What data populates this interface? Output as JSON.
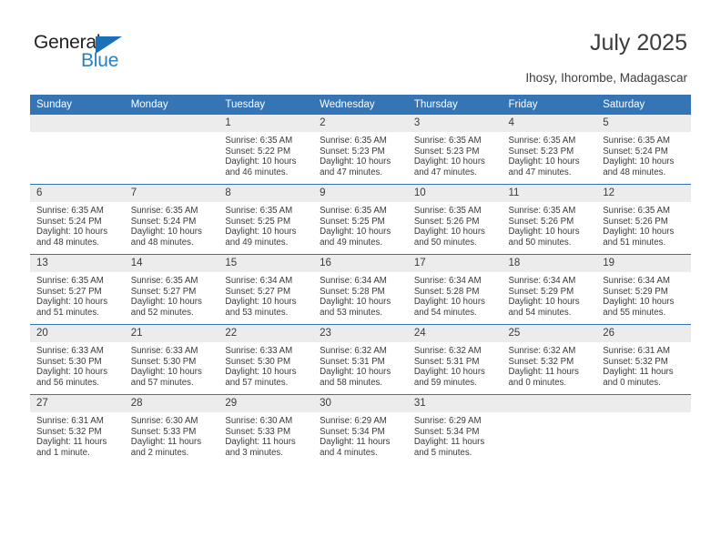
{
  "brand": {
    "name_top": "General",
    "name_bottom": "Blue",
    "triangle_color": "#1b70b8",
    "blue_text_color": "#2980c4"
  },
  "header": {
    "title": "July 2025",
    "subtitle": "Ihosy, Ihorombe, Madagascar"
  },
  "theme": {
    "header_blue": "#3575b5",
    "daynum_band": "#ececec",
    "text": "#3a3a3a"
  },
  "weekdays": [
    "Sunday",
    "Monday",
    "Tuesday",
    "Wednesday",
    "Thursday",
    "Friday",
    "Saturday"
  ],
  "labels": {
    "sunrise_prefix": "Sunrise:",
    "sunset_prefix": "Sunset:",
    "daylight_prefix": "Daylight:"
  },
  "weeks": [
    [
      {
        "day": "",
        "sunrise": "",
        "sunset": "",
        "daylight": ""
      },
      {
        "day": "",
        "sunrise": "",
        "sunset": "",
        "daylight": ""
      },
      {
        "day": "1",
        "sunrise": "Sunrise: 6:35 AM",
        "sunset": "Sunset: 5:22 PM",
        "daylight": "Daylight: 10 hours and 46 minutes."
      },
      {
        "day": "2",
        "sunrise": "Sunrise: 6:35 AM",
        "sunset": "Sunset: 5:23 PM",
        "daylight": "Daylight: 10 hours and 47 minutes."
      },
      {
        "day": "3",
        "sunrise": "Sunrise: 6:35 AM",
        "sunset": "Sunset: 5:23 PM",
        "daylight": "Daylight: 10 hours and 47 minutes."
      },
      {
        "day": "4",
        "sunrise": "Sunrise: 6:35 AM",
        "sunset": "Sunset: 5:23 PM",
        "daylight": "Daylight: 10 hours and 47 minutes."
      },
      {
        "day": "5",
        "sunrise": "Sunrise: 6:35 AM",
        "sunset": "Sunset: 5:24 PM",
        "daylight": "Daylight: 10 hours and 48 minutes."
      }
    ],
    [
      {
        "day": "6",
        "sunrise": "Sunrise: 6:35 AM",
        "sunset": "Sunset: 5:24 PM",
        "daylight": "Daylight: 10 hours and 48 minutes."
      },
      {
        "day": "7",
        "sunrise": "Sunrise: 6:35 AM",
        "sunset": "Sunset: 5:24 PM",
        "daylight": "Daylight: 10 hours and 48 minutes."
      },
      {
        "day": "8",
        "sunrise": "Sunrise: 6:35 AM",
        "sunset": "Sunset: 5:25 PM",
        "daylight": "Daylight: 10 hours and 49 minutes."
      },
      {
        "day": "9",
        "sunrise": "Sunrise: 6:35 AM",
        "sunset": "Sunset: 5:25 PM",
        "daylight": "Daylight: 10 hours and 49 minutes."
      },
      {
        "day": "10",
        "sunrise": "Sunrise: 6:35 AM",
        "sunset": "Sunset: 5:26 PM",
        "daylight": "Daylight: 10 hours and 50 minutes."
      },
      {
        "day": "11",
        "sunrise": "Sunrise: 6:35 AM",
        "sunset": "Sunset: 5:26 PM",
        "daylight": "Daylight: 10 hours and 50 minutes."
      },
      {
        "day": "12",
        "sunrise": "Sunrise: 6:35 AM",
        "sunset": "Sunset: 5:26 PM",
        "daylight": "Daylight: 10 hours and 51 minutes."
      }
    ],
    [
      {
        "day": "13",
        "sunrise": "Sunrise: 6:35 AM",
        "sunset": "Sunset: 5:27 PM",
        "daylight": "Daylight: 10 hours and 51 minutes."
      },
      {
        "day": "14",
        "sunrise": "Sunrise: 6:35 AM",
        "sunset": "Sunset: 5:27 PM",
        "daylight": "Daylight: 10 hours and 52 minutes."
      },
      {
        "day": "15",
        "sunrise": "Sunrise: 6:34 AM",
        "sunset": "Sunset: 5:27 PM",
        "daylight": "Daylight: 10 hours and 53 minutes."
      },
      {
        "day": "16",
        "sunrise": "Sunrise: 6:34 AM",
        "sunset": "Sunset: 5:28 PM",
        "daylight": "Daylight: 10 hours and 53 minutes."
      },
      {
        "day": "17",
        "sunrise": "Sunrise: 6:34 AM",
        "sunset": "Sunset: 5:28 PM",
        "daylight": "Daylight: 10 hours and 54 minutes."
      },
      {
        "day": "18",
        "sunrise": "Sunrise: 6:34 AM",
        "sunset": "Sunset: 5:29 PM",
        "daylight": "Daylight: 10 hours and 54 minutes."
      },
      {
        "day": "19",
        "sunrise": "Sunrise: 6:34 AM",
        "sunset": "Sunset: 5:29 PM",
        "daylight": "Daylight: 10 hours and 55 minutes."
      }
    ],
    [
      {
        "day": "20",
        "sunrise": "Sunrise: 6:33 AM",
        "sunset": "Sunset: 5:30 PM",
        "daylight": "Daylight: 10 hours and 56 minutes."
      },
      {
        "day": "21",
        "sunrise": "Sunrise: 6:33 AM",
        "sunset": "Sunset: 5:30 PM",
        "daylight": "Daylight: 10 hours and 57 minutes."
      },
      {
        "day": "22",
        "sunrise": "Sunrise: 6:33 AM",
        "sunset": "Sunset: 5:30 PM",
        "daylight": "Daylight: 10 hours and 57 minutes."
      },
      {
        "day": "23",
        "sunrise": "Sunrise: 6:32 AM",
        "sunset": "Sunset: 5:31 PM",
        "daylight": "Daylight: 10 hours and 58 minutes."
      },
      {
        "day": "24",
        "sunrise": "Sunrise: 6:32 AM",
        "sunset": "Sunset: 5:31 PM",
        "daylight": "Daylight: 10 hours and 59 minutes."
      },
      {
        "day": "25",
        "sunrise": "Sunrise: 6:32 AM",
        "sunset": "Sunset: 5:32 PM",
        "daylight": "Daylight: 11 hours and 0 minutes."
      },
      {
        "day": "26",
        "sunrise": "Sunrise: 6:31 AM",
        "sunset": "Sunset: 5:32 PM",
        "daylight": "Daylight: 11 hours and 0 minutes."
      }
    ],
    [
      {
        "day": "27",
        "sunrise": "Sunrise: 6:31 AM",
        "sunset": "Sunset: 5:32 PM",
        "daylight": "Daylight: 11 hours and 1 minute."
      },
      {
        "day": "28",
        "sunrise": "Sunrise: 6:30 AM",
        "sunset": "Sunset: 5:33 PM",
        "daylight": "Daylight: 11 hours and 2 minutes."
      },
      {
        "day": "29",
        "sunrise": "Sunrise: 6:30 AM",
        "sunset": "Sunset: 5:33 PM",
        "daylight": "Daylight: 11 hours and 3 minutes."
      },
      {
        "day": "30",
        "sunrise": "Sunrise: 6:29 AM",
        "sunset": "Sunset: 5:34 PM",
        "daylight": "Daylight: 11 hours and 4 minutes."
      },
      {
        "day": "31",
        "sunrise": "Sunrise: 6:29 AM",
        "sunset": "Sunset: 5:34 PM",
        "daylight": "Daylight: 11 hours and 5 minutes."
      },
      {
        "day": "",
        "sunrise": "",
        "sunset": "",
        "daylight": ""
      },
      {
        "day": "",
        "sunrise": "",
        "sunset": "",
        "daylight": ""
      }
    ]
  ]
}
